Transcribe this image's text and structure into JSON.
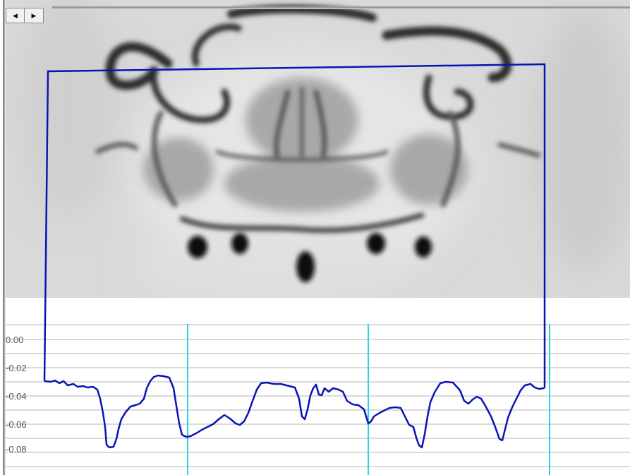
{
  "toolbar": {
    "scroll_left_glyph": "◀",
    "scroll_right_glyph": "▶"
  },
  "colors": {
    "profile_line": "#0a14b4",
    "marker_line": "#29d3e6",
    "grid_line": "#b4b4b4",
    "tick_text": "#555555"
  },
  "chart_data": {
    "type": "line",
    "yticks": [
      "0.00",
      "-0.02",
      "-0.04",
      "-0.06",
      "-0.08"
    ],
    "ylim": [
      -0.1,
      0.01
    ],
    "grid": true
  }
}
